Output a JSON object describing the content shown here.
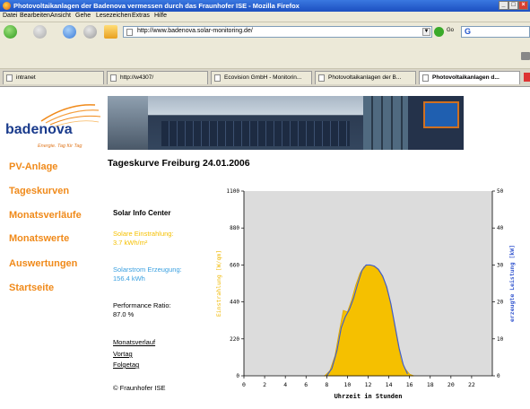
{
  "window": {
    "title": "Photovoltaikanlagen der Badenova vermessen durch das Fraunhofer ISE - Mozilla Firefox"
  },
  "menu": [
    "Datei",
    "Bearbeiten",
    "Ansicht",
    "Gehe",
    "Lesezeichen",
    "Extras",
    "Hilfe"
  ],
  "navigation": {
    "url": "http://www.badenova.solar-monitoring.de/",
    "go_label": "Go",
    "search_placeholder": ""
  },
  "tabs": [
    {
      "label": "intranet"
    },
    {
      "label": "http://w4307/"
    },
    {
      "label": "Ecovision GmbH - Monitorin..."
    },
    {
      "label": "Photovoltaikanlagen der B..."
    },
    {
      "label": "Photovoltaikanlagen d..."
    }
  ],
  "logo": {
    "name": "badenova",
    "slogan": "Energie. Tag für Tag"
  },
  "sidenav": [
    "PV-Anlage",
    "Tageskurven",
    "Monatsverläufe",
    "Monatswerte",
    "Auswertungen",
    "Startseite"
  ],
  "page": {
    "title": "Tageskurve Freiburg 24.01.2006"
  },
  "info": {
    "heading": "Solar Info Center",
    "irradiation_label": "Solare Einstrahlung:",
    "irradiation_value": "3.7 kWh/m²",
    "production_label": "Solarstrom Erzeugung:",
    "production_value": "156.4 kWh",
    "pr_label": "Performance Ratio:",
    "pr_value": "87.0 %",
    "links": [
      "Monatsverlauf",
      "Vortag",
      "Folgetag"
    ],
    "copyright": "© Fraunhofer ISE"
  },
  "colors": {
    "brand_orange": "#f08a1a",
    "irradiation": "#f5c000",
    "power": "#3a5bd0",
    "info_blue": "#3aa0e0"
  },
  "chart_data": {
    "type": "area",
    "xlabel": "Uhrzeit in Stunden",
    "ylabel_left": "Einstrahlung [W/qm]",
    "ylabel_right": "erzeugte Leistung [kW]",
    "xlim": [
      0,
      24
    ],
    "ylim_left": [
      0,
      1100
    ],
    "ylim_right": [
      0,
      50
    ],
    "xticks": [
      0,
      2,
      4,
      6,
      8,
      10,
      12,
      14,
      16,
      18,
      20,
      22
    ],
    "yticks_left": [
      0,
      220,
      440,
      660,
      880,
      1100
    ],
    "yticks_right": [
      0,
      10,
      20,
      30,
      40,
      50
    ],
    "series": [
      {
        "name": "Einstrahlung [W/qm]",
        "axis": "left",
        "x": [
          7.8,
          8.3,
          8.8,
          9.2,
          9.6,
          10.0,
          10.4,
          10.8,
          11.2,
          11.6,
          12.0,
          12.4,
          12.8,
          13.2,
          13.6,
          14.0,
          14.4,
          14.8,
          15.2,
          15.6,
          16.0,
          16.4
        ],
        "values": [
          0,
          30,
          120,
          260,
          390,
          380,
          450,
          540,
          610,
          650,
          660,
          655,
          640,
          610,
          560,
          470,
          350,
          210,
          90,
          40,
          10,
          0
        ]
      },
      {
        "name": "erzeugte Leistung [kW]",
        "axis": "right",
        "x": [
          8.0,
          8.5,
          9.0,
          9.4,
          9.8,
          10.2,
          10.6,
          11.0,
          11.4,
          11.8,
          12.2,
          12.6,
          13.0,
          13.4,
          13.8,
          14.2,
          14.6,
          15.0,
          15.4,
          15.8
        ],
        "values": [
          0,
          2,
          7,
          13,
          16,
          18,
          21,
          25,
          28.5,
          30,
          30,
          29.7,
          28.8,
          27,
          24,
          19.5,
          13.5,
          7.5,
          3,
          0.5
        ]
      }
    ]
  }
}
